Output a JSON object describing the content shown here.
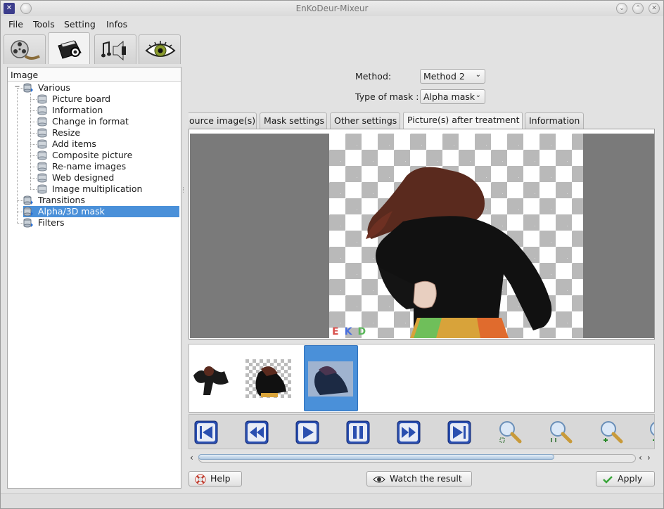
{
  "window": {
    "title": "EnKoDeur-Mixeur"
  },
  "menu": [
    {
      "label": "File"
    },
    {
      "label": "Tools"
    },
    {
      "label": "Setting"
    },
    {
      "label": "Infos"
    }
  ],
  "main_tabs": [
    {
      "icon": "film-reel-icon"
    },
    {
      "icon": "camera-icon"
    },
    {
      "icon": "music-speaker-icon"
    },
    {
      "icon": "eye-icon"
    }
  ],
  "tree": {
    "header": "Image",
    "items": [
      {
        "label": "Various",
        "level": 0,
        "expanded": true
      },
      {
        "label": "Picture board",
        "level": 1
      },
      {
        "label": "Information",
        "level": 1
      },
      {
        "label": "Change in format",
        "level": 1
      },
      {
        "label": "Resize",
        "level": 1
      },
      {
        "label": "Add items",
        "level": 1
      },
      {
        "label": "Composite picture",
        "level": 1
      },
      {
        "label": "Re-name images",
        "level": 1
      },
      {
        "label": "Web designed",
        "level": 1
      },
      {
        "label": "Image multiplication",
        "level": 1
      },
      {
        "label": "Transitions",
        "level": 0
      },
      {
        "label": "Alpha/3D mask",
        "level": 0,
        "selected": true
      },
      {
        "label": "Filters",
        "level": 0
      }
    ]
  },
  "form": {
    "method_label": "Method:",
    "method_value": "Method 2",
    "mask_label": "Type of mask :",
    "mask_value": "Alpha mask"
  },
  "sub_tabs": [
    {
      "label": "ource image(s)"
    },
    {
      "label": "Mask settings"
    },
    {
      "label": "Other settings"
    },
    {
      "label": "Picture(s) after treatment",
      "active": true
    },
    {
      "label": "Information"
    }
  ],
  "preview": {
    "watermark": [
      "E",
      "K",
      "D"
    ],
    "watermark_colors": [
      "#d9534f",
      "#4a6fdc",
      "#5cb85c"
    ]
  },
  "playback": [
    {
      "icon": "skip-to-start-icon"
    },
    {
      "icon": "rewind-icon"
    },
    {
      "icon": "play-icon"
    },
    {
      "icon": "pause-icon"
    },
    {
      "icon": "fast-forward-icon"
    },
    {
      "icon": "skip-to-end-icon"
    },
    {
      "icon": "zoom-fit-icon"
    },
    {
      "icon": "zoom-1to1-icon"
    },
    {
      "icon": "zoom-in-icon"
    },
    {
      "icon": "zoom-out-icon"
    }
  ],
  "buttons": {
    "help": "Help",
    "watch": "Watch the result",
    "apply": "Apply"
  },
  "colors": {
    "selection": "#4a90d9",
    "preview_bg": "#7a7a7a"
  }
}
